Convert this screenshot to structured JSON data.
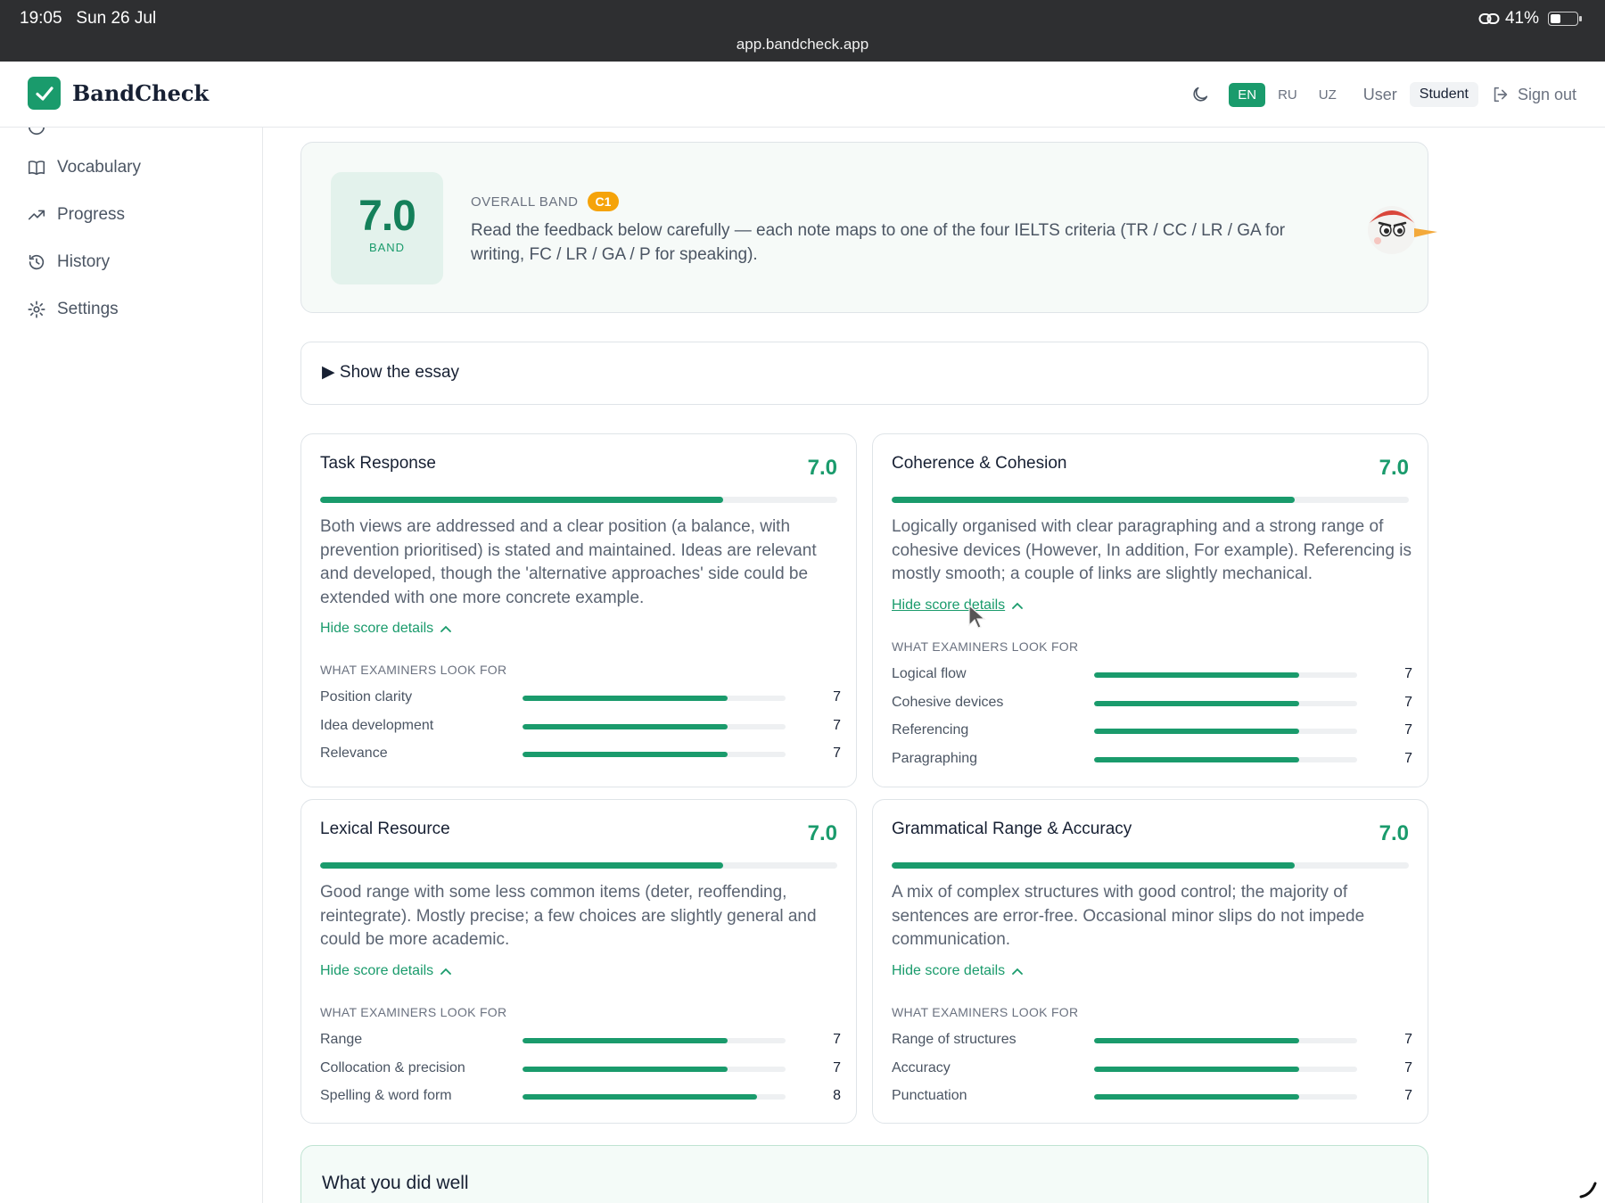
{
  "status_bar": {
    "time": "19:05",
    "date": "Sun 26 Jul",
    "url": "app.bandcheck.app",
    "battery": "41%",
    "battery_level": 0.41
  },
  "header": {
    "brand": "BandCheck",
    "languages": [
      "EN",
      "RU",
      "UZ"
    ],
    "active_language": "EN",
    "user_label": "User",
    "role": "Student",
    "sign_out": "Sign out"
  },
  "sidebar": {
    "items": [
      {
        "label": "Vocabulary",
        "icon": "book-icon"
      },
      {
        "label": "Progress",
        "icon": "trend-up-icon"
      },
      {
        "label": "History",
        "icon": "history-icon"
      },
      {
        "label": "Settings",
        "icon": "gear-icon"
      }
    ]
  },
  "overall": {
    "band": "7.0",
    "band_label": "BAND",
    "label": "OVERALL BAND",
    "level": "C1",
    "text": "Read the feedback below carefully — each note maps to one of the four IELTS criteria (TR / CC / LR / GA for writing, FC / LR / GA / P for speaking)."
  },
  "essay_toggle": "▶ Show the essay",
  "criteria": [
    {
      "title": "Task Response",
      "score": "7.0",
      "level": 0.78,
      "desc": "Both views are addressed and a clear position (a balance, with prevention prioritised) is stated and maintained. Ideas are relevant and developed, though the 'alternative approaches' side could be extended with one more concrete example.",
      "toggle": "Hide score details",
      "examiners": "WHAT EXAMINERS LOOK FOR",
      "sub": [
        {
          "label": "Position clarity",
          "value": "7",
          "level": 0.78
        },
        {
          "label": "Idea development",
          "value": "7",
          "level": 0.78
        },
        {
          "label": "Relevance",
          "value": "7",
          "level": 0.78
        }
      ]
    },
    {
      "title": "Coherence & Cohesion",
      "score": "7.0",
      "level": 0.78,
      "desc": "Logically organised with clear paragraphing and a strong range of cohesive devices (However, In addition, For example). Referencing is mostly smooth; a couple of links are slightly mechanical.",
      "toggle": "Hide score details",
      "examiners": "WHAT EXAMINERS LOOK FOR",
      "sub": [
        {
          "label": "Logical flow",
          "value": "7",
          "level": 0.78
        },
        {
          "label": "Cohesive devices",
          "value": "7",
          "level": 0.78
        },
        {
          "label": "Referencing",
          "value": "7",
          "level": 0.78
        },
        {
          "label": "Paragraphing",
          "value": "7",
          "level": 0.78
        }
      ]
    },
    {
      "title": "Lexical Resource",
      "score": "7.0",
      "level": 0.78,
      "desc": "Good range with some less common items (deter, reoffending, reintegrate). Mostly precise; a few choices are slightly general and could be more academic.",
      "toggle": "Hide score details",
      "examiners": "WHAT EXAMINERS LOOK FOR",
      "sub": [
        {
          "label": "Range",
          "value": "7",
          "level": 0.78
        },
        {
          "label": "Collocation & precision",
          "value": "7",
          "level": 0.78
        },
        {
          "label": "Spelling & word form",
          "value": "8",
          "level": 0.89
        }
      ]
    },
    {
      "title": "Grammatical Range & Accuracy",
      "score": "7.0",
      "level": 0.78,
      "desc": "A mix of complex structures with good control; the majority of sentences are error-free. Occasional minor slips do not impede communication.",
      "toggle": "Hide score details",
      "examiners": "WHAT EXAMINERS LOOK FOR",
      "sub": [
        {
          "label": "Range of structures",
          "value": "7",
          "level": 0.78
        },
        {
          "label": "Accuracy",
          "value": "7",
          "level": 0.78
        },
        {
          "label": "Punctuation",
          "value": "7",
          "level": 0.78
        }
      ]
    }
  ],
  "did_well": {
    "title": "What you did well"
  },
  "colors": {
    "accent": "#1a9b6c",
    "badge": "#f5a30a",
    "statusbar": "#2e2f31"
  }
}
